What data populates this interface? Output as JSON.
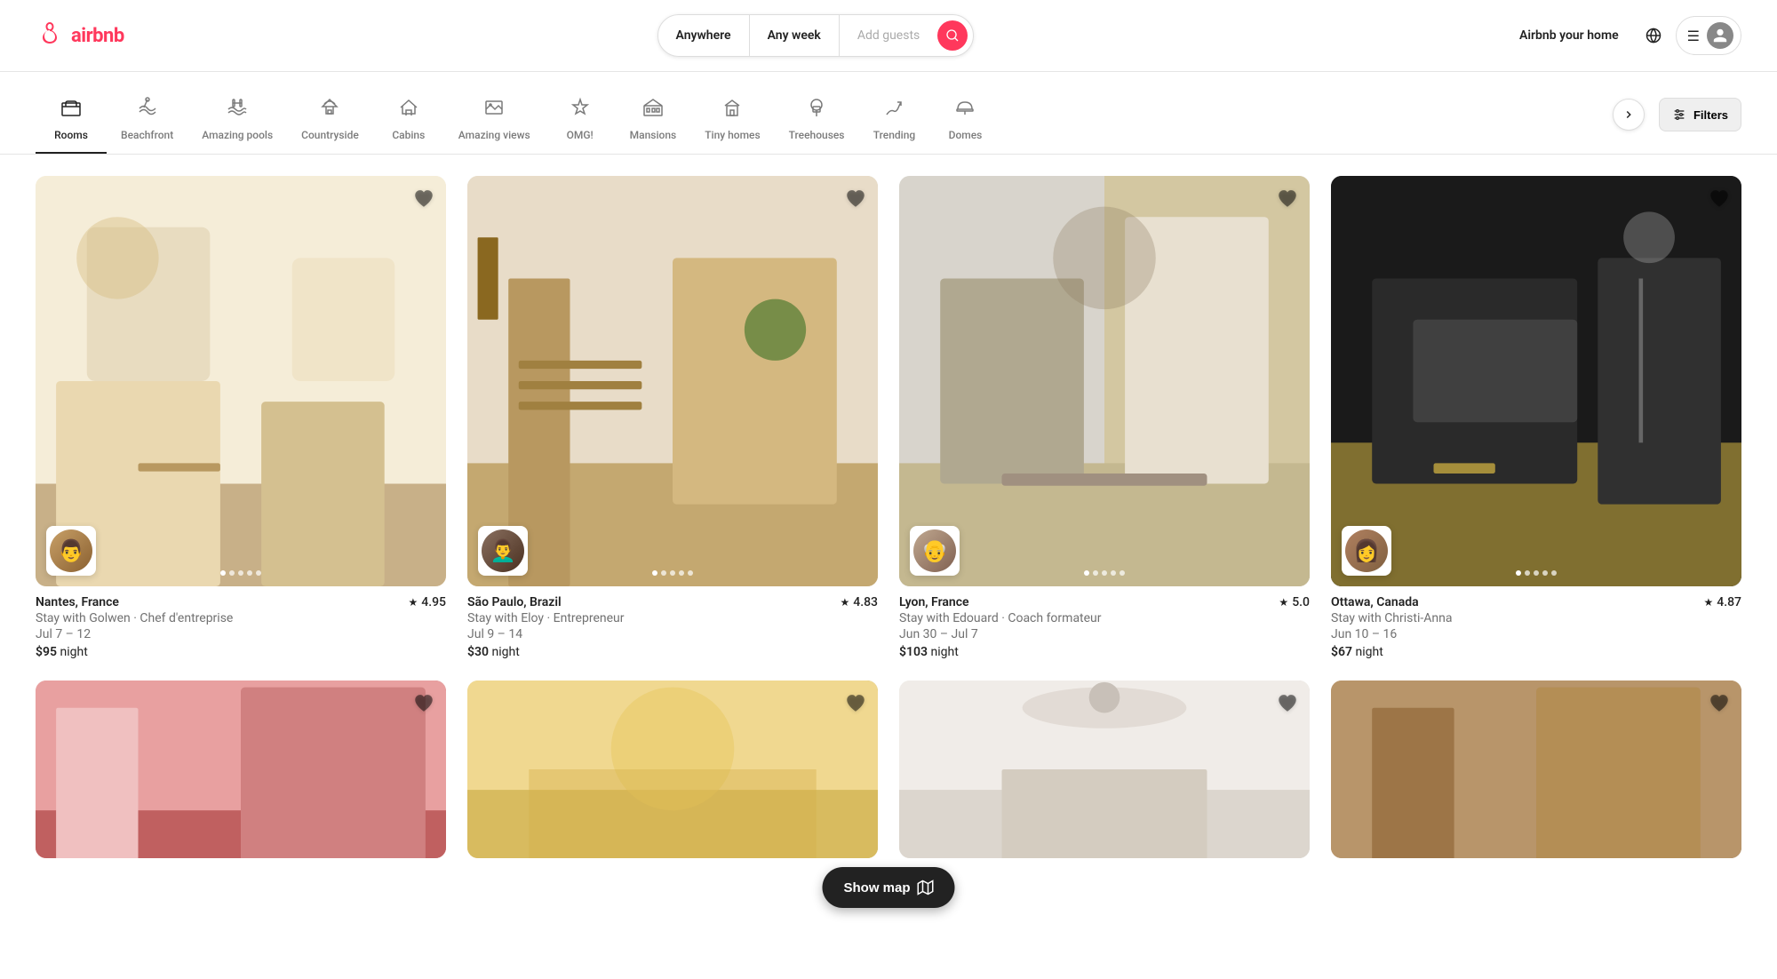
{
  "header": {
    "logo_text": "airbnb",
    "search": {
      "location_label": "Anywhere",
      "dates_label": "Any week",
      "guests_placeholder": "Add guests"
    },
    "nav": {
      "host_label": "Airbnb your home",
      "menu_icon": "☰"
    }
  },
  "categories": [
    {
      "id": "rooms",
      "label": "Rooms",
      "icon": "🛏",
      "active": true
    },
    {
      "id": "beachfront",
      "label": "Beachfront",
      "icon": "🏖",
      "active": false
    },
    {
      "id": "amazing-pools",
      "label": "Amazing pools",
      "icon": "🌊",
      "active": false
    },
    {
      "id": "countryside",
      "label": "Countryside",
      "icon": "🌿",
      "active": false
    },
    {
      "id": "cabins",
      "label": "Cabins",
      "icon": "🏡",
      "active": false
    },
    {
      "id": "amazing-views",
      "label": "Amazing views",
      "icon": "🌄",
      "active": false
    },
    {
      "id": "omg",
      "label": "OMG!",
      "icon": "🏛",
      "active": false
    },
    {
      "id": "mansions",
      "label": "Mansions",
      "icon": "🏰",
      "active": false
    },
    {
      "id": "tiny-homes",
      "label": "Tiny homes",
      "icon": "🏘",
      "active": false
    },
    {
      "id": "treehouses",
      "label": "Treehouses",
      "icon": "🌲",
      "active": false
    },
    {
      "id": "trending",
      "label": "Trending",
      "icon": "🔥",
      "active": false
    },
    {
      "id": "domes",
      "label": "Domes",
      "icon": "⬡",
      "active": false
    }
  ],
  "filters_label": "Filters",
  "listings": [
    {
      "id": "nantes",
      "location": "Nantes, France",
      "rating": "4.95",
      "host_desc": "Stay with Golwen · Chef d'entreprise",
      "dates": "Jul 7 – 12",
      "price": "$95",
      "price_unit": "night",
      "img_class": "room-nantes",
      "host_emoji": "👨"
    },
    {
      "id": "saopaulo",
      "location": "São Paulo, Brazil",
      "rating": "4.83",
      "host_desc": "Stay with Eloy · Entrepreneur",
      "dates": "Jul 9 – 14",
      "price": "$30",
      "price_unit": "night",
      "img_class": "room-saopaulo",
      "host_emoji": "👨‍🦱"
    },
    {
      "id": "lyon",
      "location": "Lyon, France",
      "rating": "5.0",
      "host_desc": "Stay with Edouard · Coach formateur",
      "dates": "Jun 30 – Jul 7",
      "price": "$103",
      "price_unit": "night",
      "img_class": "room-lyon",
      "host_emoji": "👴"
    },
    {
      "id": "ottawa",
      "location": "Ottawa, Canada",
      "rating": "4.87",
      "host_desc": "Stay with Christi-Anna",
      "dates": "Jun 10 – 16",
      "price": "$67",
      "price_unit": "night",
      "img_class": "room-ottawa",
      "host_emoji": "👩"
    }
  ],
  "row2": [
    {
      "id": "r2a",
      "img_class": "img-row2a"
    },
    {
      "id": "r2b",
      "img_class": "img-row2b"
    },
    {
      "id": "r2c",
      "img_class": "img-row2c"
    },
    {
      "id": "r2d",
      "img_class": "img-row2d"
    }
  ],
  "show_map": {
    "label": "Show map",
    "icon": "⊞"
  }
}
